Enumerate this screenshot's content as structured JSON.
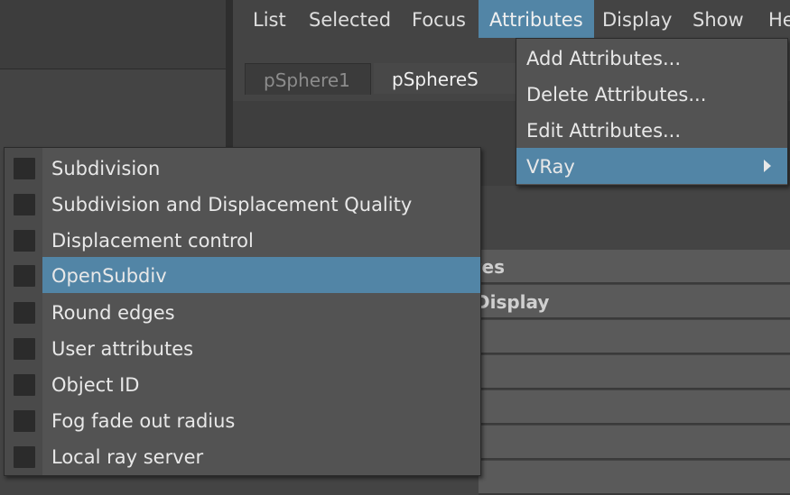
{
  "menubar": {
    "items": [
      "List",
      "Selected",
      "Focus",
      "Attributes",
      "Display",
      "Show",
      "He"
    ],
    "active": "Attributes"
  },
  "tabs": [
    "pSphere1",
    "pSphereS"
  ],
  "attributes_menu": {
    "items": [
      {
        "label": "Add Attributes...",
        "has_submenu": false
      },
      {
        "label": "Delete Attributes...",
        "has_submenu": false
      },
      {
        "label": "Edit Attributes...",
        "has_submenu": false
      },
      {
        "label": "VRay",
        "has_submenu": true
      }
    ],
    "active": "VRay"
  },
  "vray_submenu": {
    "items": [
      "Subdivision",
      "Subdivision and Displacement Quality",
      "Displacement control",
      "OpenSubdiv",
      "Round edges",
      "User attributes",
      "Object ID",
      "Fog fade out radius",
      "Local ray server"
    ],
    "active": "OpenSubdiv",
    "checked": [
      false,
      false,
      false,
      false,
      false,
      false,
      false,
      false,
      false
    ]
  },
  "attribute_sections": [
    "tes",
    "Display"
  ],
  "colors": {
    "highlight": "#5285a6",
    "menu_bg": "#535353",
    "background": "#444444"
  }
}
